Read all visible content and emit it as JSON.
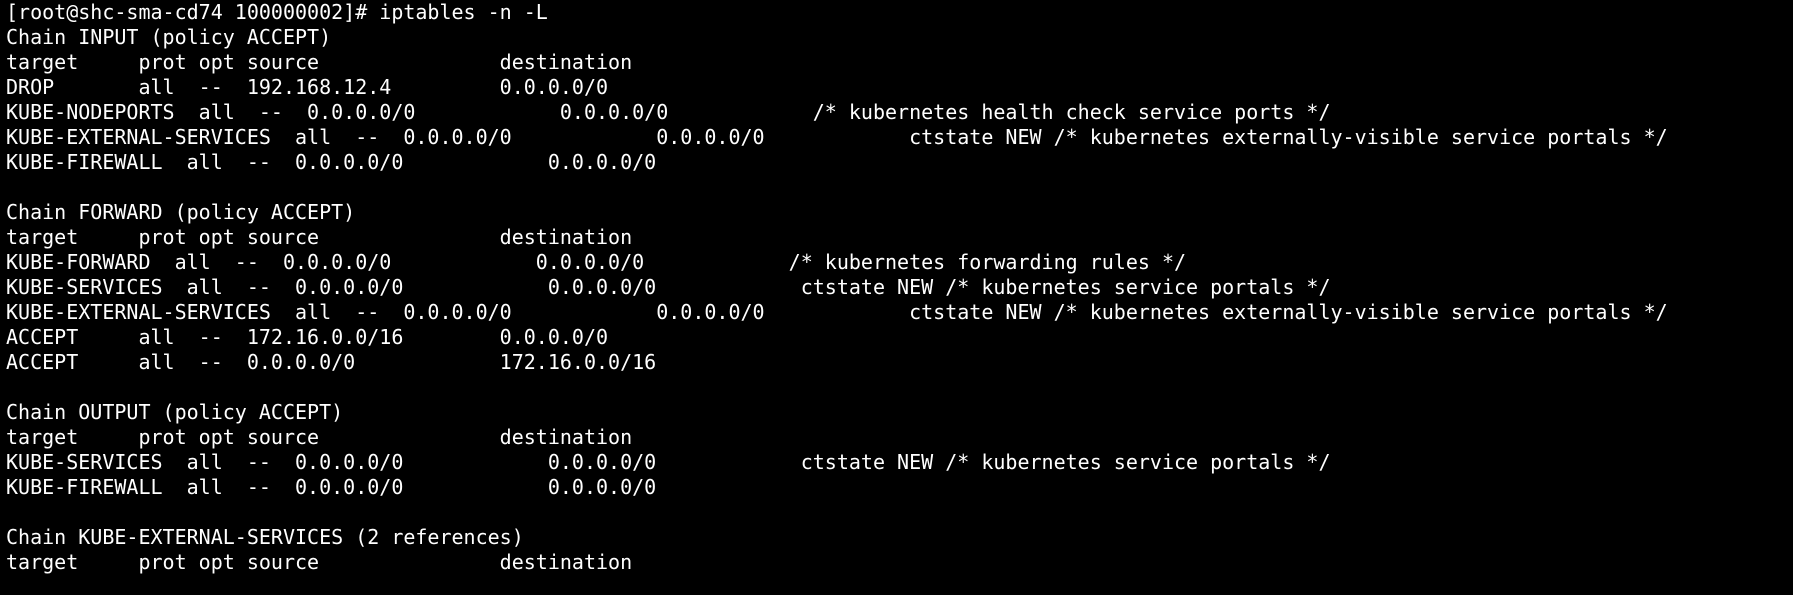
{
  "colors": {
    "background": "#000000",
    "foreground": "#ffffff"
  },
  "terminal": {
    "prompt": "[root@shc-sma-cd74 100000002]# iptables -n -L",
    "lines": [
      "Chain INPUT (policy ACCEPT)",
      "target     prot opt source               destination",
      "DROP       all  --  192.168.12.4         0.0.0.0/0",
      "KUBE-NODEPORTS  all  --  0.0.0.0/0            0.0.0.0/0            /* kubernetes health check service ports */",
      "KUBE-EXTERNAL-SERVICES  all  --  0.0.0.0/0            0.0.0.0/0            ctstate NEW /* kubernetes externally-visible service portals */",
      "KUBE-FIREWALL  all  --  0.0.0.0/0            0.0.0.0/0",
      "",
      "Chain FORWARD (policy ACCEPT)",
      "target     prot opt source               destination",
      "KUBE-FORWARD  all  --  0.0.0.0/0            0.0.0.0/0            /* kubernetes forwarding rules */",
      "KUBE-SERVICES  all  --  0.0.0.0/0            0.0.0.0/0            ctstate NEW /* kubernetes service portals */",
      "KUBE-EXTERNAL-SERVICES  all  --  0.0.0.0/0            0.0.0.0/0            ctstate NEW /* kubernetes externally-visible service portals */",
      "ACCEPT     all  --  172.16.0.0/16        0.0.0.0/0",
      "ACCEPT     all  --  0.0.0.0/0            172.16.0.0/16",
      "",
      "Chain OUTPUT (policy ACCEPT)",
      "target     prot opt source               destination",
      "KUBE-SERVICES  all  --  0.0.0.0/0            0.0.0.0/0            ctstate NEW /* kubernetes service portals */",
      "KUBE-FIREWALL  all  --  0.0.0.0/0            0.0.0.0/0",
      "",
      "Chain KUBE-EXTERNAL-SERVICES (2 references)",
      "target     prot opt source               destination"
    ]
  }
}
